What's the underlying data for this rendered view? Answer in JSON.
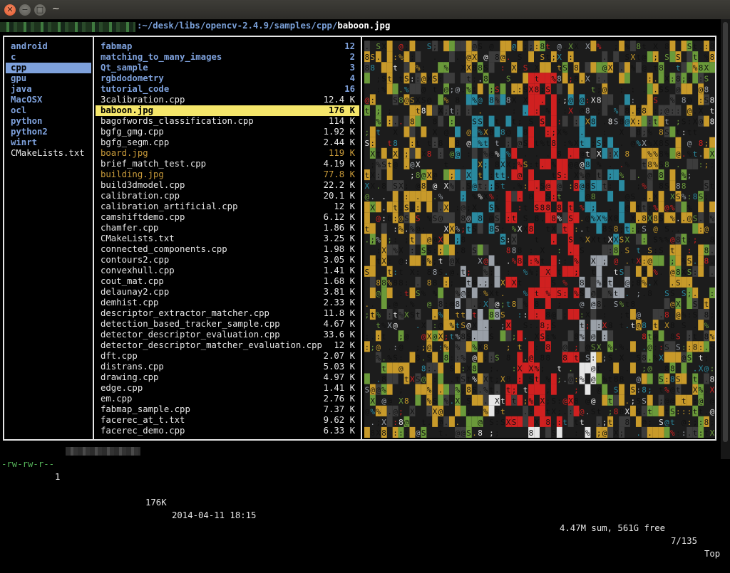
{
  "window": {
    "title": "~",
    "close_glyph": "✕",
    "min_glyph": "−",
    "max_glyph": "□"
  },
  "path": {
    "dir": ":~/desk/libs/opencv-2.4.9/samples/cpp/",
    "file": "baboon.jpg"
  },
  "left_column": [
    {
      "name": "android",
      "type": "dir"
    },
    {
      "name": "c",
      "type": "dir"
    },
    {
      "name": "cpp",
      "type": "dir",
      "selected": true
    },
    {
      "name": "gpu",
      "type": "dir"
    },
    {
      "name": "java",
      "type": "dir"
    },
    {
      "name": "MacOSX",
      "type": "dir"
    },
    {
      "name": "ocl",
      "type": "dir"
    },
    {
      "name": "python",
      "type": "dir"
    },
    {
      "name": "python2",
      "type": "dir"
    },
    {
      "name": "winrt",
      "type": "dir"
    },
    {
      "name": "CMakeLists.txt",
      "type": "file"
    }
  ],
  "main_column": [
    {
      "name": "fabmap",
      "size": "12",
      "type": "dir"
    },
    {
      "name": "matching_to_many_images",
      "size": "2",
      "type": "dir"
    },
    {
      "name": "Qt_sample",
      "size": "3",
      "type": "dir"
    },
    {
      "name": "rgbdodometry",
      "size": "4",
      "type": "dir"
    },
    {
      "name": "tutorial_code",
      "size": "16",
      "type": "dir"
    },
    {
      "name": "3calibration.cpp",
      "size": "12.4 K",
      "type": "file"
    },
    {
      "name": "baboon.jpg",
      "size": "176 K",
      "type": "media",
      "selected": true
    },
    {
      "name": "bagofwords_classification.cpp",
      "size": "114 K",
      "type": "file"
    },
    {
      "name": "bgfg_gmg.cpp",
      "size": "1.92 K",
      "type": "file"
    },
    {
      "name": "bgfg_segm.cpp",
      "size": "2.44 K",
      "type": "file"
    },
    {
      "name": "board.jpg",
      "size": "119 K",
      "type": "media"
    },
    {
      "name": "brief_match_test.cpp",
      "size": "4.19 K",
      "type": "file"
    },
    {
      "name": "building.jpg",
      "size": "77.8 K",
      "type": "media"
    },
    {
      "name": "build3dmodel.cpp",
      "size": "22.2 K",
      "type": "file"
    },
    {
      "name": "calibration.cpp",
      "size": "20.1 K",
      "type": "file"
    },
    {
      "name": "calibration_artificial.cpp",
      "size": "12 K",
      "type": "file"
    },
    {
      "name": "camshiftdemo.cpp",
      "size": "6.12 K",
      "type": "file"
    },
    {
      "name": "chamfer.cpp",
      "size": "1.86 K",
      "type": "file"
    },
    {
      "name": "CMakeLists.txt",
      "size": "3.25 K",
      "type": "file"
    },
    {
      "name": "connected_components.cpp",
      "size": "1.98 K",
      "type": "file"
    },
    {
      "name": "contours2.cpp",
      "size": "3.05 K",
      "type": "file"
    },
    {
      "name": "convexhull.cpp",
      "size": "1.41 K",
      "type": "file"
    },
    {
      "name": "cout_mat.cpp",
      "size": "1.68 K",
      "type": "file"
    },
    {
      "name": "delaunay2.cpp",
      "size": "3.81 K",
      "type": "file"
    },
    {
      "name": "demhist.cpp",
      "size": "2.33 K",
      "type": "file"
    },
    {
      "name": "descriptor_extractor_matcher.cpp",
      "size": "11.8 K",
      "type": "file"
    },
    {
      "name": "detection_based_tracker_sample.cpp",
      "size": "4.67 K",
      "type": "file"
    },
    {
      "name": "detector_descriptor_evaluation.cpp",
      "size": "33.6 K",
      "type": "file"
    },
    {
      "name": "detector_descriptor_matcher_evaluation.cpp",
      "size": "12 K",
      "type": "file"
    },
    {
      "name": "dft.cpp",
      "size": "2.07 K",
      "type": "file"
    },
    {
      "name": "distrans.cpp",
      "size": "5.03 K",
      "type": "file"
    },
    {
      "name": "drawing.cpp",
      "size": "4.97 K",
      "type": "file"
    },
    {
      "name": "edge.cpp",
      "size": "1.41 K",
      "type": "file"
    },
    {
      "name": "em.cpp",
      "size": "2.76 K",
      "type": "file"
    },
    {
      "name": "fabmap_sample.cpp",
      "size": "7.37 K",
      "type": "file"
    },
    {
      "name": "facerec_at_t.txt",
      "size": "9.62 K",
      "type": "file"
    },
    {
      "name": "facerec_demo.cpp",
      "size": "6.33 K",
      "type": "file"
    }
  ],
  "preview": {
    "glyphs": "8S%X@t:;.",
    "colors": [
      "#c89a2a",
      "#9aa0a8",
      "#2a8aa0",
      "#d02020",
      "#e6e6e6",
      "#6a9a3a",
      "#3c3c3c"
    ]
  },
  "status": {
    "permissions": "-rw-rw-r--",
    "links": "1",
    "size": "176K",
    "date": "2014-04-11 18:15",
    "summary": "4.47M sum, 561G free",
    "position": "7/135",
    "scroll": "Top"
  }
}
